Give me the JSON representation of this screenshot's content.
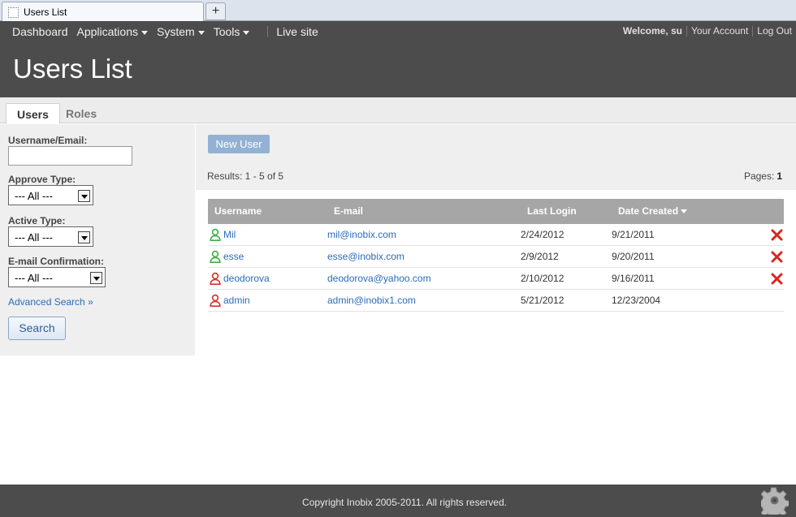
{
  "browser": {
    "tab_title": "Users List",
    "new_tab_label": "+"
  },
  "nav": {
    "items": [
      {
        "label": "Dashboard",
        "dropdown": false
      },
      {
        "label": "Applications",
        "dropdown": true
      },
      {
        "label": "System",
        "dropdown": true
      },
      {
        "label": "Tools",
        "dropdown": true
      }
    ],
    "live_site": "Live site",
    "welcome": "Welcome, su",
    "account": "Your Account",
    "logout": "Log Out"
  },
  "page": {
    "title": "Users List"
  },
  "tabs": [
    {
      "label": "Users",
      "active": true
    },
    {
      "label": "Roles",
      "active": false
    }
  ],
  "filter": {
    "username_label": "Username/Email:",
    "username_value": "",
    "approve_label": "Approve Type:",
    "approve_value": "--- All ---",
    "active_label": "Active Type:",
    "active_value": "--- All ---",
    "email_conf_label": "E-mail Confirmation:",
    "email_conf_value": "--- All ---",
    "advanced_search": "Advanced Search »",
    "search_button": "Search"
  },
  "main": {
    "new_user_button": "New User",
    "results": "Results: 1 - 5 of 5",
    "pages_label": "Pages:",
    "page_number": "1"
  },
  "table": {
    "headers": {
      "username": "Username",
      "email": "E-mail",
      "last_login": "Last Login",
      "date_created": "Date Created"
    },
    "rows": [
      {
        "username": "Mil",
        "email": "mil@inobix.com",
        "last_login": "2/24/2012",
        "date_created": "9/21/2011",
        "status": "active",
        "deletable": true
      },
      {
        "username": "esse",
        "email": "esse@inobix.com",
        "last_login": "2/9/2012",
        "date_created": "9/20/2011",
        "status": "active",
        "deletable": true
      },
      {
        "username": "deodorova",
        "email": "deodorova@yahoo.com",
        "last_login": "2/10/2012",
        "date_created": "9/16/2011",
        "status": "inactive",
        "deletable": true
      },
      {
        "username": "admin",
        "email": "admin@inobix1.com",
        "last_login": "5/21/2012",
        "date_created": "12/23/2004",
        "status": "inactive",
        "deletable": false
      }
    ]
  },
  "footer": {
    "copyright": "Copyright Inobix 2005-2011. All rights reserved."
  },
  "colors": {
    "header_bg": "#4c4c4c",
    "link": "#2b6cb8",
    "active_user": "#3fae49",
    "inactive_user": "#d0342c",
    "delete": "#d8261c"
  }
}
